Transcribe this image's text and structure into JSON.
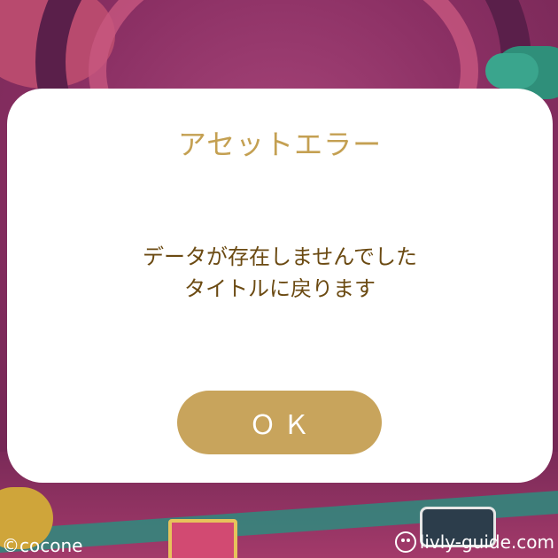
{
  "dialog": {
    "title": "アセットエラー",
    "message_line1": "データが存在しませんでした",
    "message_line2": "タイトルに戻ります",
    "ok_label": "ＯＫ"
  },
  "watermark": {
    "copyright": "©cocone",
    "site": "livly-guide.com"
  },
  "colors": {
    "title": "#c4a052",
    "message": "#6b4a12",
    "button": "#c8a45c",
    "dialog_bg": "#ffffff"
  }
}
